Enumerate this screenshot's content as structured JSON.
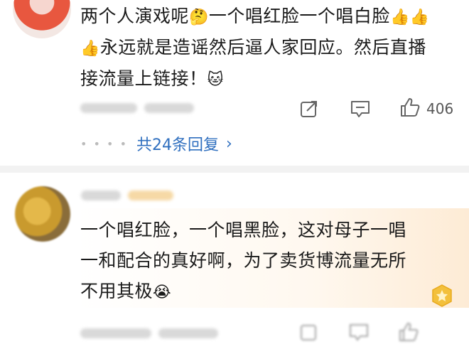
{
  "comment1": {
    "lines": [
      "两个人演戏呢",
      "一个唱红脸一个唱白脸",
      "永远就是造谣然后逼人家回应。然后直播",
      "接流量上链接！"
    ],
    "like_count": "406",
    "replies_label": "共24条回复"
  },
  "comment2": {
    "lines": [
      "一个唱红脸，一个唱黑脸，这对母子一唱",
      "一和配合的真好啊，为了卖货博流量无所",
      "不用其极"
    ]
  },
  "colors": {
    "link": "#2f6fbf",
    "icon": "#666666",
    "divider": "#f2f2f2"
  },
  "emojis": {
    "thinking": "🤔",
    "thumbs_up": "👍",
    "cat": "🐱",
    "crying": "😭"
  }
}
